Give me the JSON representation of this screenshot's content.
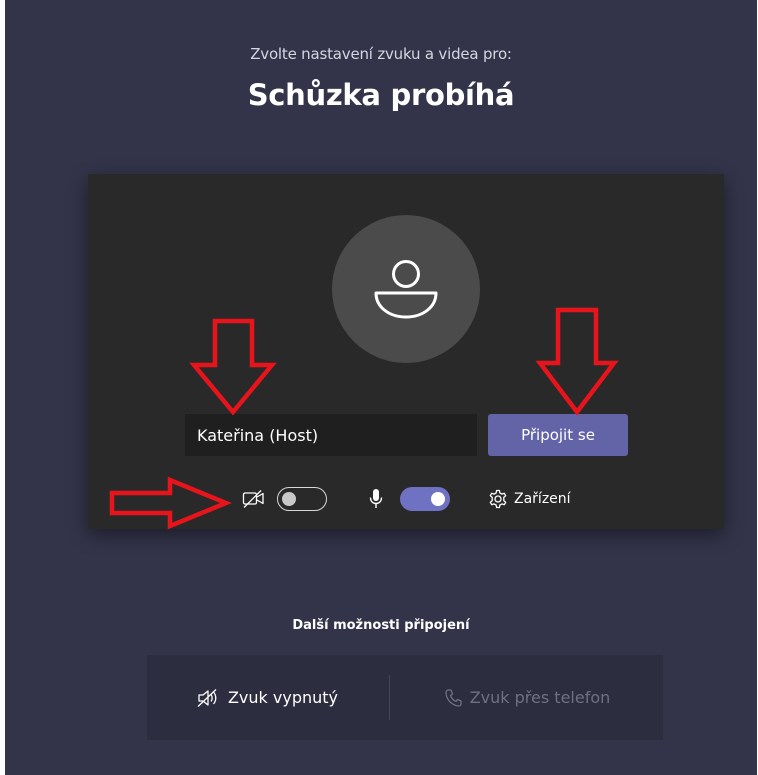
{
  "header": {
    "subtitle": "Zvolte nastavení zvuku a videa pro:",
    "title": "Schůzka probíhá"
  },
  "preview": {
    "avatar_icon": "person-icon",
    "name_value": "Kateřina (Host)",
    "join_label": "Připojit se",
    "camera": {
      "icon": "camera-off-icon",
      "enabled": false
    },
    "microphone": {
      "icon": "microphone-icon",
      "enabled": true
    },
    "devices": {
      "icon": "gear-icon",
      "label": "Zařízení"
    }
  },
  "more_options": {
    "title": "Další možnosti připojení",
    "audio_off": {
      "icon": "speaker-off-icon",
      "label": "Zvuk vypnutý"
    },
    "phone_audio": {
      "icon": "phone-icon",
      "label": "Zvuk přes telefon"
    }
  },
  "colors": {
    "background": "#33344a",
    "preview_panel": "#292929",
    "accent": "#6264a7",
    "annotation_arrow": "#e8141c"
  }
}
